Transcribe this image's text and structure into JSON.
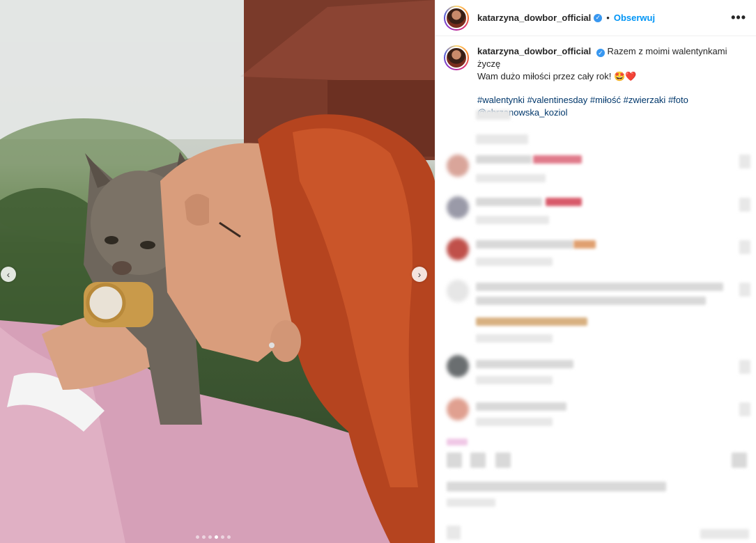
{
  "post": {
    "username": "katarzyna_dowbor_official",
    "verified_mark": "✓",
    "separator": "•",
    "follow_label": "Obserwuj",
    "more_label": "•••",
    "caption_line1": "Razem z moimi walentynkami życzę",
    "caption_line2": "Wam dużo miłości przez cały rok! 🤩❤️",
    "hashtags": [
      "#walentynki",
      "#valentinesday",
      "#miłość",
      "#zwierzaki",
      "#foto"
    ],
    "mention": "@chrzanowska_koziol"
  },
  "carousel": {
    "prev_label": "‹",
    "next_label": "›",
    "slide_count": 6,
    "active_slide": 4
  },
  "icons": {
    "prev": "chevron-left-icon",
    "next": "chevron-right-icon",
    "verified": "verified-badge-icon",
    "more": "more-options-icon"
  },
  "colors": {
    "link": "#00376b",
    "follow": "#0095f6",
    "verified": "#3897f0"
  }
}
